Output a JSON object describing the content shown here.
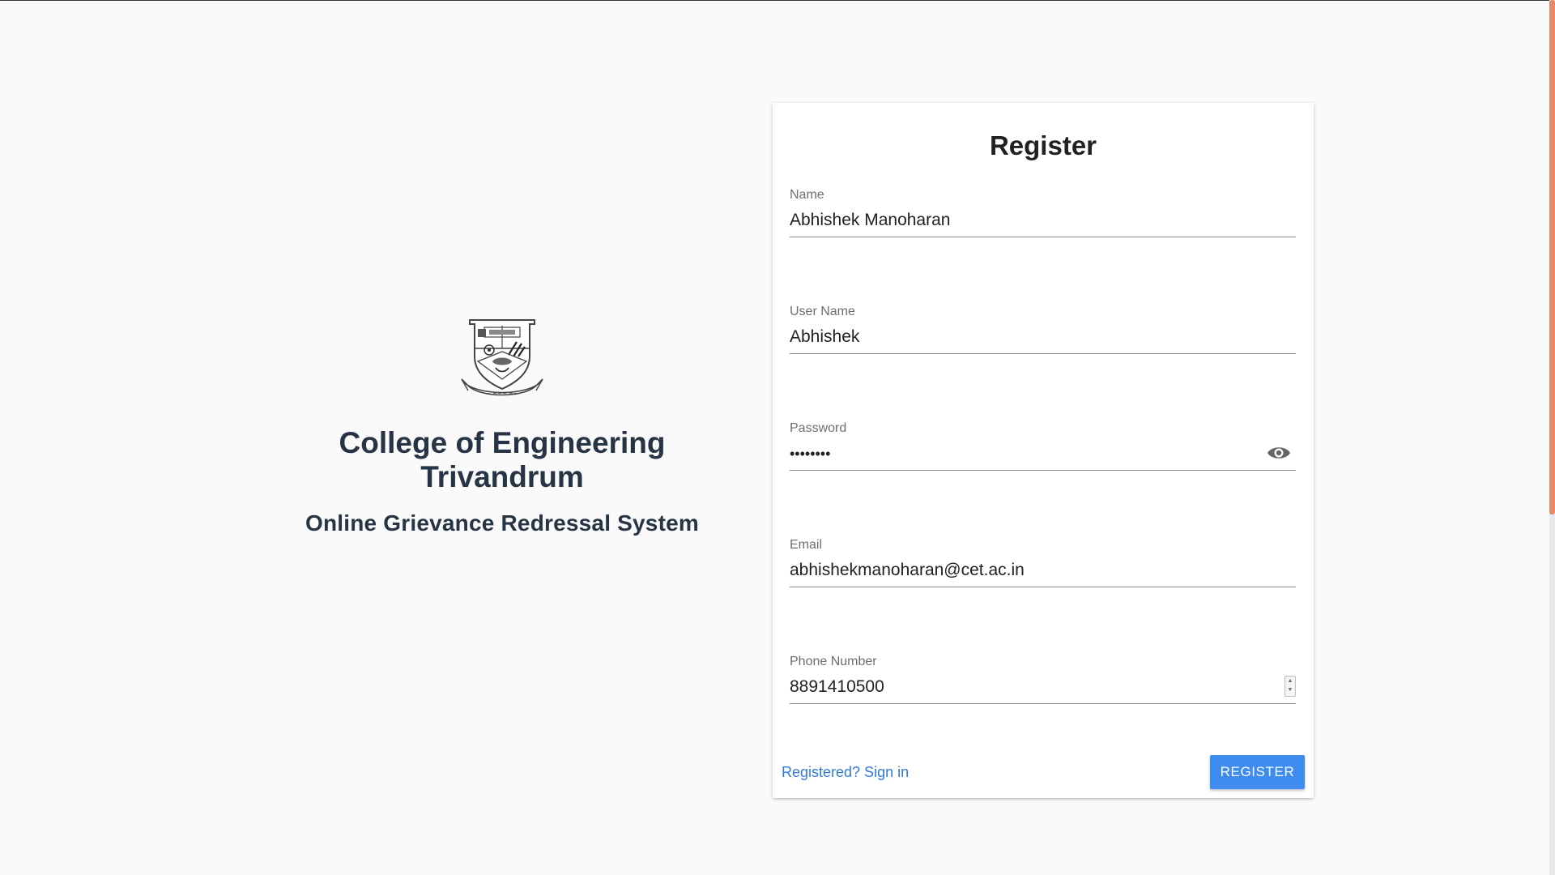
{
  "brand": {
    "college_line1": "College of Engineering",
    "college_line2": "Trivandrum",
    "system_name": "Online Grievance Redressal System"
  },
  "form": {
    "title": "Register",
    "fields": [
      {
        "label": "Name",
        "value": "Abhishek Manoharan"
      },
      {
        "label": "User Name",
        "value": "Abhishek"
      },
      {
        "label": "Password",
        "value": "••••••••"
      },
      {
        "label": "Email",
        "value": "abhishekmanoharan@cet.ac.in"
      },
      {
        "label": "Phone Number",
        "value": "8891410500"
      }
    ],
    "signin_link": "Registered? Sign in",
    "register_button": "REGISTER"
  },
  "icons": {
    "password_toggle": "eye-icon",
    "crest": "college-crest-logo",
    "phone_stepper": "number-stepper-icon"
  },
  "colors": {
    "accent": "#3f8cf0",
    "link": "#2f7bd8",
    "brand_text": "#263445",
    "scrollbar": "#e8896a"
  }
}
